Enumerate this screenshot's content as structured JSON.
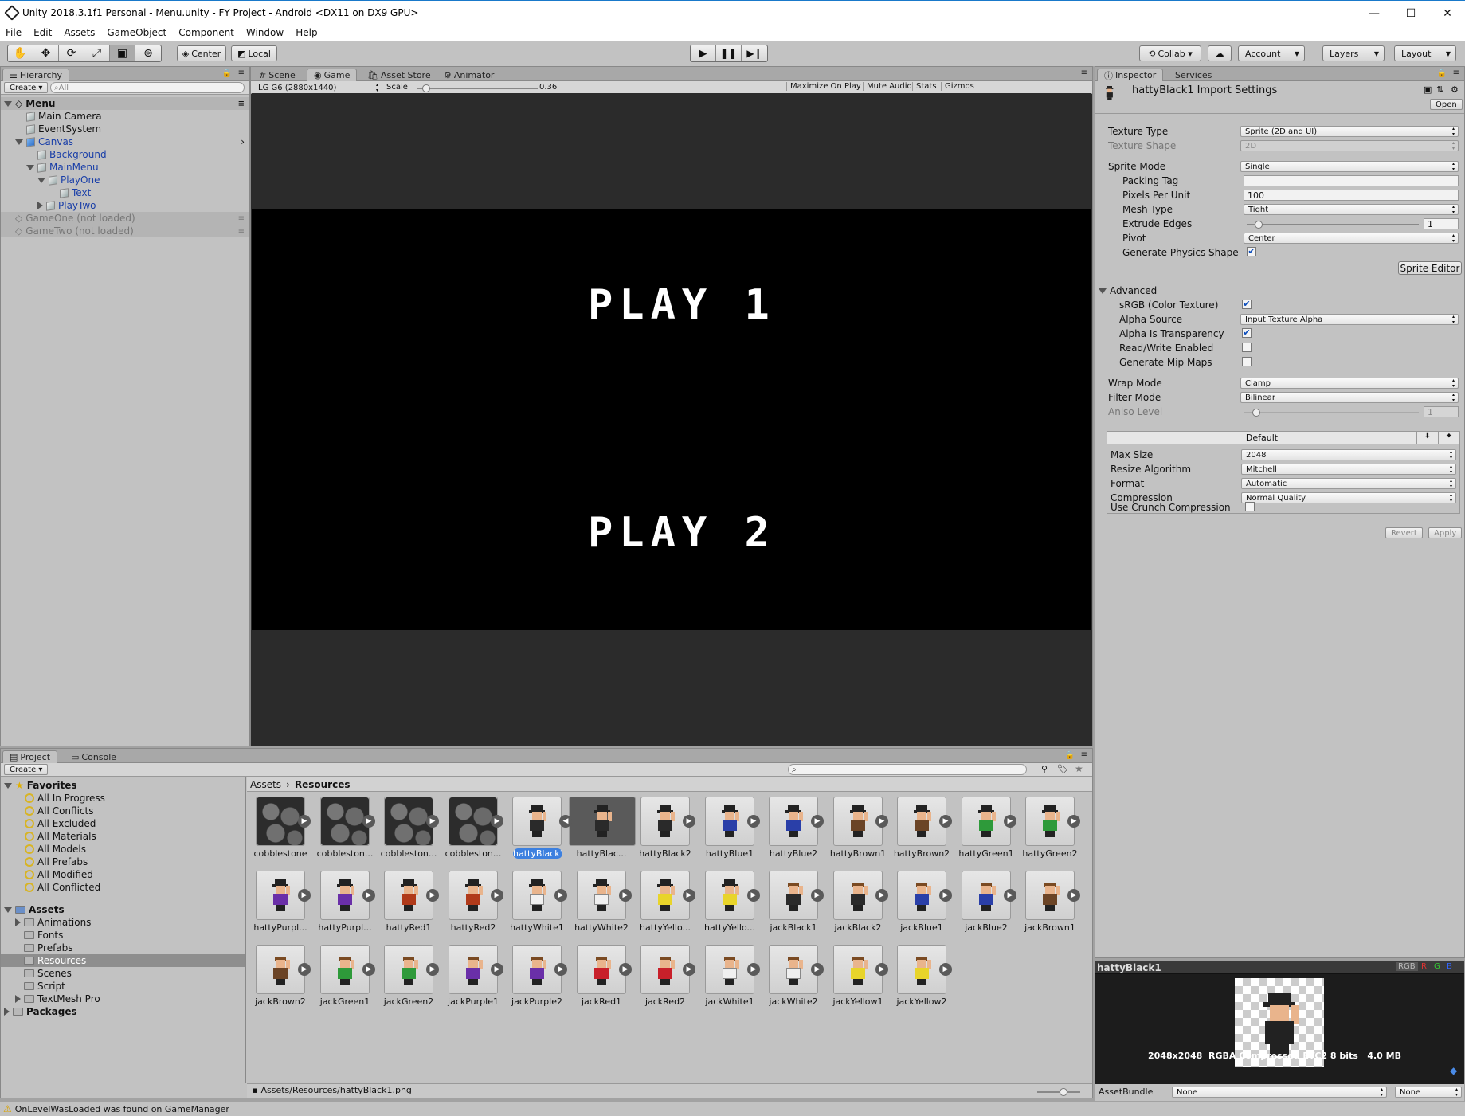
{
  "window": {
    "title": "Unity 2018.3.1f1 Personal - Menu.unity - FY Project - Android <DX11 on DX9 GPU>",
    "minimize": "—",
    "maximize": "☐",
    "close": "✕"
  },
  "menu": [
    "File",
    "Edit",
    "Assets",
    "GameObject",
    "Component",
    "Window",
    "Help"
  ],
  "toolbar": {
    "pivot_center": "Center",
    "pivot_local": "Local",
    "collab": "Collab ▾",
    "account": "Account",
    "layers": "Layers",
    "layout": "Layout"
  },
  "hierarchy": {
    "tab": "Hierarchy",
    "create": "Create",
    "search_placeholder": "All",
    "rows": [
      {
        "label": "Menu",
        "indent": 0,
        "kind": "scene",
        "open": true
      },
      {
        "label": "Main Camera",
        "indent": 1,
        "kind": "obj"
      },
      {
        "label": "EventSystem",
        "indent": 1,
        "kind": "obj"
      },
      {
        "label": "Canvas",
        "indent": 1,
        "kind": "obj",
        "open": true,
        "blue": true
      },
      {
        "label": "Background",
        "indent": 2,
        "kind": "obj",
        "blue": true
      },
      {
        "label": "MainMenu",
        "indent": 2,
        "kind": "obj",
        "open": true,
        "blue": true
      },
      {
        "label": "PlayOne",
        "indent": 3,
        "kind": "obj",
        "open": true,
        "blue": true
      },
      {
        "label": "Text",
        "indent": 4,
        "kind": "obj",
        "blue": true
      },
      {
        "label": "PlayTwo",
        "indent": 3,
        "kind": "obj",
        "closed": true,
        "blue": true
      },
      {
        "label": "GameOne (not loaded)",
        "indent": 0,
        "kind": "scene",
        "dim": true
      },
      {
        "label": "GameTwo (not loaded)",
        "indent": 0,
        "kind": "scene",
        "dim": true
      }
    ]
  },
  "center_tabs": [
    "Scene",
    "Game",
    "Asset Store",
    "Animator"
  ],
  "game": {
    "resolution": "LG G6 (2880x1440)",
    "scale_label": "Scale",
    "scale_value": "0.36",
    "scale_fraction": 0.05,
    "maximize": "Maximize On Play",
    "mute": "Mute Audio",
    "stats": "Stats",
    "gizmos": "Gizmos",
    "play1": "PLAY 1",
    "play2": "PLAY 2"
  },
  "inspector": {
    "tabs": [
      "Inspector",
      "Services"
    ],
    "title": "hattyBlack1 Import Settings",
    "open": "Open",
    "texture_type": {
      "label": "Texture Type",
      "value": "Sprite (2D and UI)"
    },
    "texture_shape": {
      "label": "Texture Shape",
      "value": "2D"
    },
    "sprite_mode": {
      "label": "Sprite Mode",
      "value": "Single"
    },
    "packing_tag": {
      "label": "Packing Tag",
      "value": ""
    },
    "ppu": {
      "label": "Pixels Per Unit",
      "value": "100"
    },
    "mesh_type": {
      "label": "Mesh Type",
      "value": "Tight"
    },
    "extrude": {
      "label": "Extrude Edges",
      "value": "1",
      "fraction": 0.05
    },
    "pivot": {
      "label": "Pivot",
      "value": "Center"
    },
    "physics": {
      "label": "Generate Physics Shape",
      "checked": true
    },
    "sprite_editor": "Sprite Editor",
    "advanced": "Advanced",
    "srgb": {
      "label": "sRGB (Color Texture)",
      "checked": true
    },
    "alpha_source": {
      "label": "Alpha Source",
      "value": "Input Texture Alpha"
    },
    "alpha_transp": {
      "label": "Alpha Is Transparency",
      "checked": true
    },
    "readwrite": {
      "label": "Read/Write Enabled",
      "checked": false
    },
    "mipmaps": {
      "label": "Generate Mip Maps",
      "checked": false
    },
    "wrap": {
      "label": "Wrap Mode",
      "value": "Clamp"
    },
    "filter": {
      "label": "Filter Mode",
      "value": "Bilinear"
    },
    "aniso": {
      "label": "Aniso Level",
      "value": "1",
      "fraction": 0.05
    },
    "platform_default": "Default",
    "max_size": {
      "label": "Max Size",
      "value": "2048"
    },
    "resize": {
      "label": "Resize Algorithm",
      "value": "Mitchell"
    },
    "format": {
      "label": "Format",
      "value": "Automatic"
    },
    "compression": {
      "label": "Compression",
      "value": "Normal Quality"
    },
    "crunch": {
      "label": "Use Crunch Compression",
      "checked": false
    },
    "revert": "Revert",
    "apply": "Apply"
  },
  "preview": {
    "name": "hattyBlack1",
    "rgb": "RGB",
    "r": "R",
    "g": "G",
    "b": "B",
    "info": "2048x2048  RGBA Compressed ETC2 8 bits   4.0 MB",
    "assetbundle": "AssetBundle",
    "ab_none1": "None",
    "ab_none2": "None"
  },
  "project": {
    "tabs": [
      "Project",
      "Console"
    ],
    "create": "Create",
    "favorites_title": "Favorites",
    "favorites": [
      "All In Progress",
      "All Conflicts",
      "All Excluded",
      "All Materials",
      "All Models",
      "All Prefabs",
      "All Modified",
      "All Conflicted"
    ],
    "assets_title": "Assets",
    "folders": [
      {
        "label": "Animations",
        "arrow": true
      },
      {
        "label": "Fonts"
      },
      {
        "label": "Prefabs"
      },
      {
        "label": "Resources",
        "selected": true
      },
      {
        "label": "Scenes"
      },
      {
        "label": "Script"
      },
      {
        "label": "TextMesh Pro",
        "arrow": true
      }
    ],
    "packages": "Packages",
    "breadcrumb": [
      "Assets",
      "Resources"
    ],
    "path": "Assets/Resources/hattyBlack1.png",
    "items": [
      {
        "name": "cobblestone",
        "t": "stone"
      },
      {
        "name": "cobbleston...",
        "t": "stone"
      },
      {
        "name": "cobbleston...",
        "t": "stone"
      },
      {
        "name": "cobbleston...",
        "t": "stone"
      },
      {
        "name": "hattyBlack1",
        "t": "hat",
        "c": "#2a2a2a",
        "sel": true
      },
      {
        "name": "hattyBlac...",
        "t": "hat",
        "c": "#2a2a2a",
        "sel2": true
      },
      {
        "name": "hattyBlack2",
        "t": "hat",
        "c": "#2a2a2a"
      },
      {
        "name": "hattyBlue1",
        "t": "hat",
        "c": "#2a3fa8"
      },
      {
        "name": "hattyBlue2",
        "t": "hat",
        "c": "#2a3fa8"
      },
      {
        "name": "hattyBrown1",
        "t": "hat",
        "c": "#6b4426"
      },
      {
        "name": "hattyBrown2",
        "t": "hat",
        "c": "#6b4426"
      },
      {
        "name": "hattyGreen1",
        "t": "hat",
        "c": "#2e9a3a"
      },
      {
        "name": "hattyGreen2",
        "t": "hat",
        "c": "#2e9a3a"
      },
      {
        "name": "hattyPurpl...",
        "t": "hat",
        "c": "#6a2fa8"
      },
      {
        "name": "hattyPurpl...",
        "t": "hat",
        "c": "#6a2fa8"
      },
      {
        "name": "hattyRed1",
        "t": "hat",
        "c": "#b03a1a"
      },
      {
        "name": "hattyRed2",
        "t": "hat",
        "c": "#b03a1a"
      },
      {
        "name": "hattyWhite1",
        "t": "hat",
        "c": "#f0f0f0"
      },
      {
        "name": "hattyWhite2",
        "t": "hat",
        "c": "#f0f0f0"
      },
      {
        "name": "hattyYello...",
        "t": "hat",
        "c": "#e8d42a"
      },
      {
        "name": "hattyYello...",
        "t": "hat",
        "c": "#e8d42a"
      },
      {
        "name": "jackBlack1",
        "t": "jack",
        "c": "#2a2a2a"
      },
      {
        "name": "jackBlack2",
        "t": "jack",
        "c": "#2a2a2a"
      },
      {
        "name": "jackBlue1",
        "t": "jack",
        "c": "#2a3fa8"
      },
      {
        "name": "jackBlue2",
        "t": "jack",
        "c": "#2a3fa8"
      },
      {
        "name": "jackBrown1",
        "t": "jack",
        "c": "#6b4426"
      },
      {
        "name": "jackBrown2",
        "t": "jack",
        "c": "#6b4426"
      },
      {
        "name": "jackGreen1",
        "t": "jack",
        "c": "#2e9a3a"
      },
      {
        "name": "jackGreen2",
        "t": "jack",
        "c": "#2e9a3a"
      },
      {
        "name": "jackPurple1",
        "t": "jack",
        "c": "#6a2fa8"
      },
      {
        "name": "jackPurple2",
        "t": "jack",
        "c": "#6a2fa8"
      },
      {
        "name": "jackRed1",
        "t": "jack",
        "c": "#c8202a"
      },
      {
        "name": "jackRed2",
        "t": "jack",
        "c": "#c8202a"
      },
      {
        "name": "jackWhite1",
        "t": "jack",
        "c": "#f0f0f0"
      },
      {
        "name": "jackWhite2",
        "t": "jack",
        "c": "#f0f0f0"
      },
      {
        "name": "jackYellow1",
        "t": "jack",
        "c": "#e8d42a"
      },
      {
        "name": "jackYellow2",
        "t": "jack",
        "c": "#e8d42a"
      }
    ]
  },
  "status": {
    "warning": "OnLevelWasLoaded was found on GameManager"
  },
  "colors": {
    "selection": "#3d80df",
    "accent_blue": "#1979ca"
  }
}
